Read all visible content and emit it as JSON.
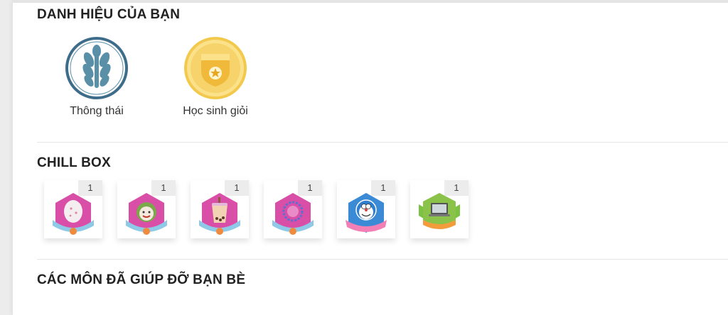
{
  "titles_section": {
    "heading": "DANH HIỆU CỦA BẠN",
    "items": [
      {
        "label": "Thông thái",
        "icon": "wheat-icon",
        "ring_color": "#3e6d8c",
        "fill_color": "#5a8fa8"
      },
      {
        "label": "Học sinh giỏi",
        "icon": "gold-shield-icon",
        "ring_color": "#f2c94c",
        "fill_color": "#f6d36b"
      }
    ]
  },
  "chill_box": {
    "heading": "CHILL BOX",
    "items": [
      {
        "count": "1",
        "icon": "egg-badge-icon"
      },
      {
        "count": "1",
        "icon": "clown-badge-icon"
      },
      {
        "count": "1",
        "icon": "bubble-tea-badge-icon"
      },
      {
        "count": "1",
        "icon": "bead-ring-badge-icon"
      },
      {
        "count": "1",
        "icon": "doraemon-badge-icon"
      },
      {
        "count": "1",
        "icon": "laptop-badge-icon"
      }
    ]
  },
  "helped_subjects": {
    "heading": "CÁC MÔN ĐÃ GIÚP ĐỠ BẠN BÈ"
  }
}
